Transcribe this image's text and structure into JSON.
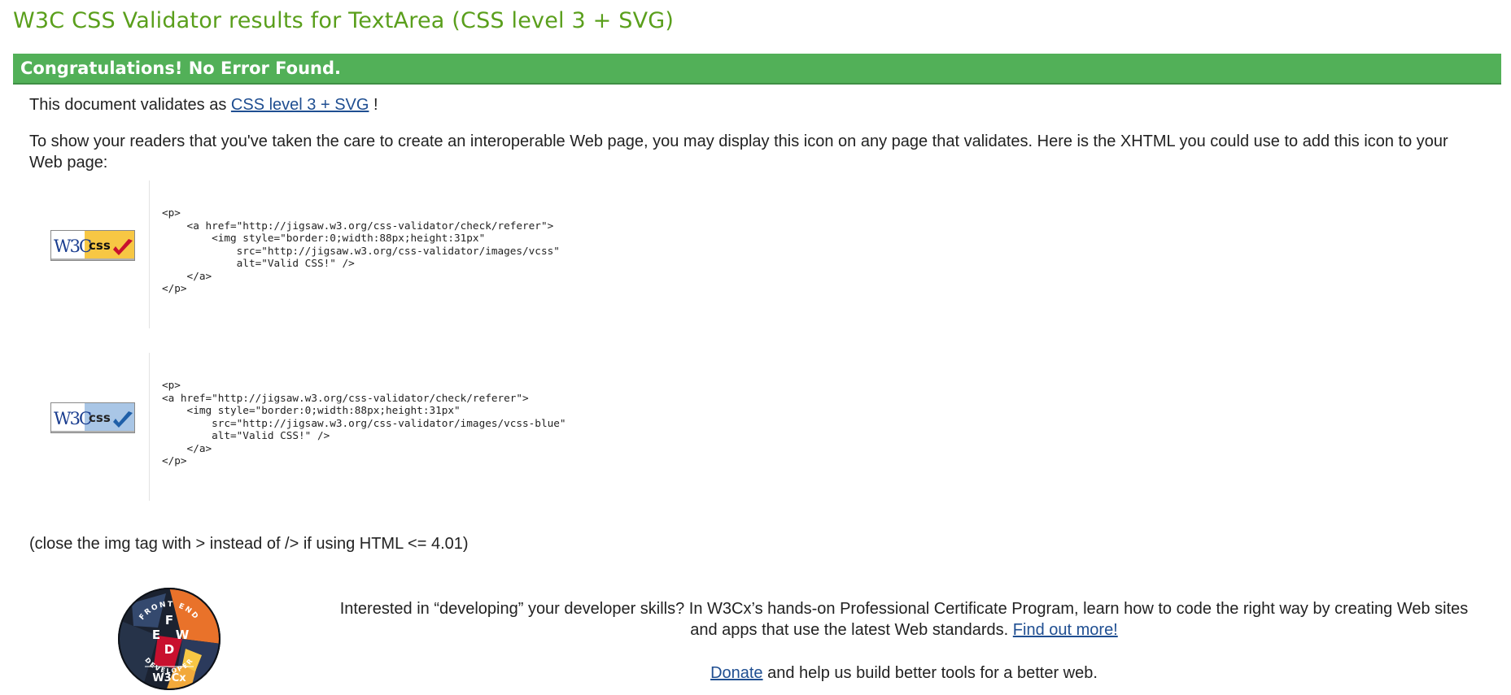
{
  "header": {
    "title": "W3C CSS Validator results for TextArea (CSS level 3 + SVG)"
  },
  "result": {
    "banner": "Congratulations! No Error Found."
  },
  "validation": {
    "prefix": "This document validates as ",
    "link": "CSS level 3 + SVG",
    "suffix": " !"
  },
  "instructions": {
    "text": "To show your readers that you've taken the care to create an interoperable Web page, you may display this icon on any page that validates. Here is the XHTML you could use to add this icon to your Web page:"
  },
  "badges": [
    {
      "name": "Valid CSS gold badge",
      "left_text": "W3C",
      "right_text": "css",
      "colors": {
        "left": "#ffffff",
        "right": "#f7c744",
        "check": "#c8102e"
      },
      "code": "<p>\n    <a href=\"http://jigsaw.w3.org/css-validator/check/referer\">\n        <img style=\"border:0;width:88px;height:31px\"\n            src=\"http://jigsaw.w3.org/css-validator/images/vcss\"\n            alt=\"Valid CSS!\" />\n    </a>\n</p>"
    },
    {
      "name": "Valid CSS blue badge",
      "left_text": "W3C",
      "right_text": "css",
      "colors": {
        "left": "#ffffff",
        "right": "#a9c6e6",
        "check": "#1f5fa8"
      },
      "code": "<p>\n<a href=\"http://jigsaw.w3.org/css-validator/check/referer\">\n    <img style=\"border:0;width:88px;height:31px\"\n        src=\"http://jigsaw.w3.org/css-validator/images/vcss-blue\"\n        alt=\"Valid CSS!\" />\n    </a>\n</p>"
    }
  ],
  "note": {
    "text": "(close the img tag with > instead of /> if using HTML <= 4.01)"
  },
  "promo": {
    "text": "Interested in “developing” your developer skills? In W3Cx’s hands-on Professional Certificate Program, learn how to code the right way by creating Web sites and apps that use the latest Web standards.",
    "link": "Find out more!",
    "logo": {
      "ring_top": "FRONT END",
      "ring_bottom": "DEVELOPER",
      "letters": [
        "F",
        "E",
        "W",
        "D"
      ],
      "brand": "W3Cx"
    }
  },
  "donate": {
    "link": "Donate",
    "text": " and help us build better tools for a better web."
  },
  "colors": {
    "title": "#5a9f1c",
    "banner": "#52b058",
    "link": "#1f4e91"
  }
}
